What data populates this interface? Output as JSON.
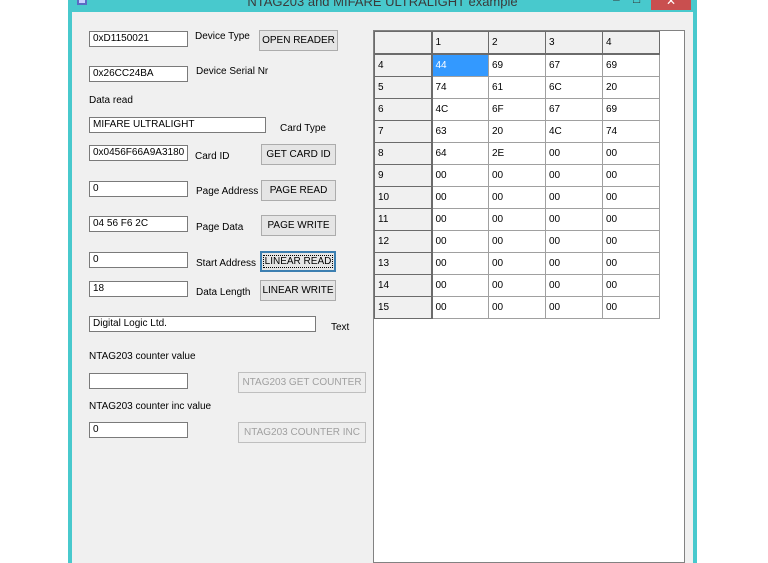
{
  "window": {
    "title": "NTAG203 and MIFARE ULTRALIGHT example",
    "minimize": "–",
    "maximize": "□",
    "close": "✕"
  },
  "fields": {
    "device_type": {
      "value": "0xD1150021",
      "label": "Device Type"
    },
    "device_serial": {
      "value": "0x26CC24BA",
      "label": "Device Serial Nr"
    },
    "data_read_label": "Data read",
    "card_type": {
      "value": "MIFARE ULTRALIGHT",
      "label": "Card Type"
    },
    "card_id": {
      "value": "0x0456F66A9A3180",
      "label": "Card ID"
    },
    "page_address": {
      "value": "0",
      "label": "Page Address"
    },
    "page_data": {
      "value": "04 56 F6 2C",
      "label": "Page Data"
    },
    "start_address": {
      "value": "0",
      "label": "Start Address"
    },
    "data_length": {
      "value": "18",
      "label": "Data Length"
    },
    "text": {
      "value": "Digital Logic Ltd.",
      "label": "Text"
    },
    "counter_value": {
      "value": "",
      "label": "NTAG203 counter value"
    },
    "counter_inc": {
      "value": "0",
      "label": "NTAG203 counter  inc value"
    }
  },
  "buttons": {
    "open_reader": "OPEN READER",
    "get_card_id": "GET CARD ID",
    "page_read": "PAGE READ",
    "page_write": "PAGE WRITE",
    "linear_read": "LINEAR READ",
    "linear_write": "LINEAR WRITE",
    "get_counter": "NTAG203 GET COUNTER",
    "counter_inc": "NTAG203 COUNTER INC"
  },
  "grid": {
    "columns": [
      "",
      "1",
      "2",
      "3",
      "4"
    ],
    "rows": [
      {
        "label": "4",
        "cells": [
          "44",
          "69",
          "67",
          "69"
        ]
      },
      {
        "label": "5",
        "cells": [
          "74",
          "61",
          "6C",
          "20"
        ]
      },
      {
        "label": "6",
        "cells": [
          "4C",
          "6F",
          "67",
          "69"
        ]
      },
      {
        "label": "7",
        "cells": [
          "63",
          "20",
          "4C",
          "74"
        ]
      },
      {
        "label": "8",
        "cells": [
          "64",
          "2E",
          "00",
          "00"
        ]
      },
      {
        "label": "9",
        "cells": [
          "00",
          "00",
          "00",
          "00"
        ]
      },
      {
        "label": "10",
        "cells": [
          "00",
          "00",
          "00",
          "00"
        ]
      },
      {
        "label": "11",
        "cells": [
          "00",
          "00",
          "00",
          "00"
        ]
      },
      {
        "label": "12",
        "cells": [
          "00",
          "00",
          "00",
          "00"
        ]
      },
      {
        "label": "13",
        "cells": [
          "00",
          "00",
          "00",
          "00"
        ]
      },
      {
        "label": "14",
        "cells": [
          "00",
          "00",
          "00",
          "00"
        ]
      },
      {
        "label": "15",
        "cells": [
          "00",
          "00",
          "00",
          "00"
        ]
      }
    ]
  },
  "colors": {
    "frame": "#48c9cd",
    "close": "#c94f4f",
    "selection": "#3399ff"
  }
}
